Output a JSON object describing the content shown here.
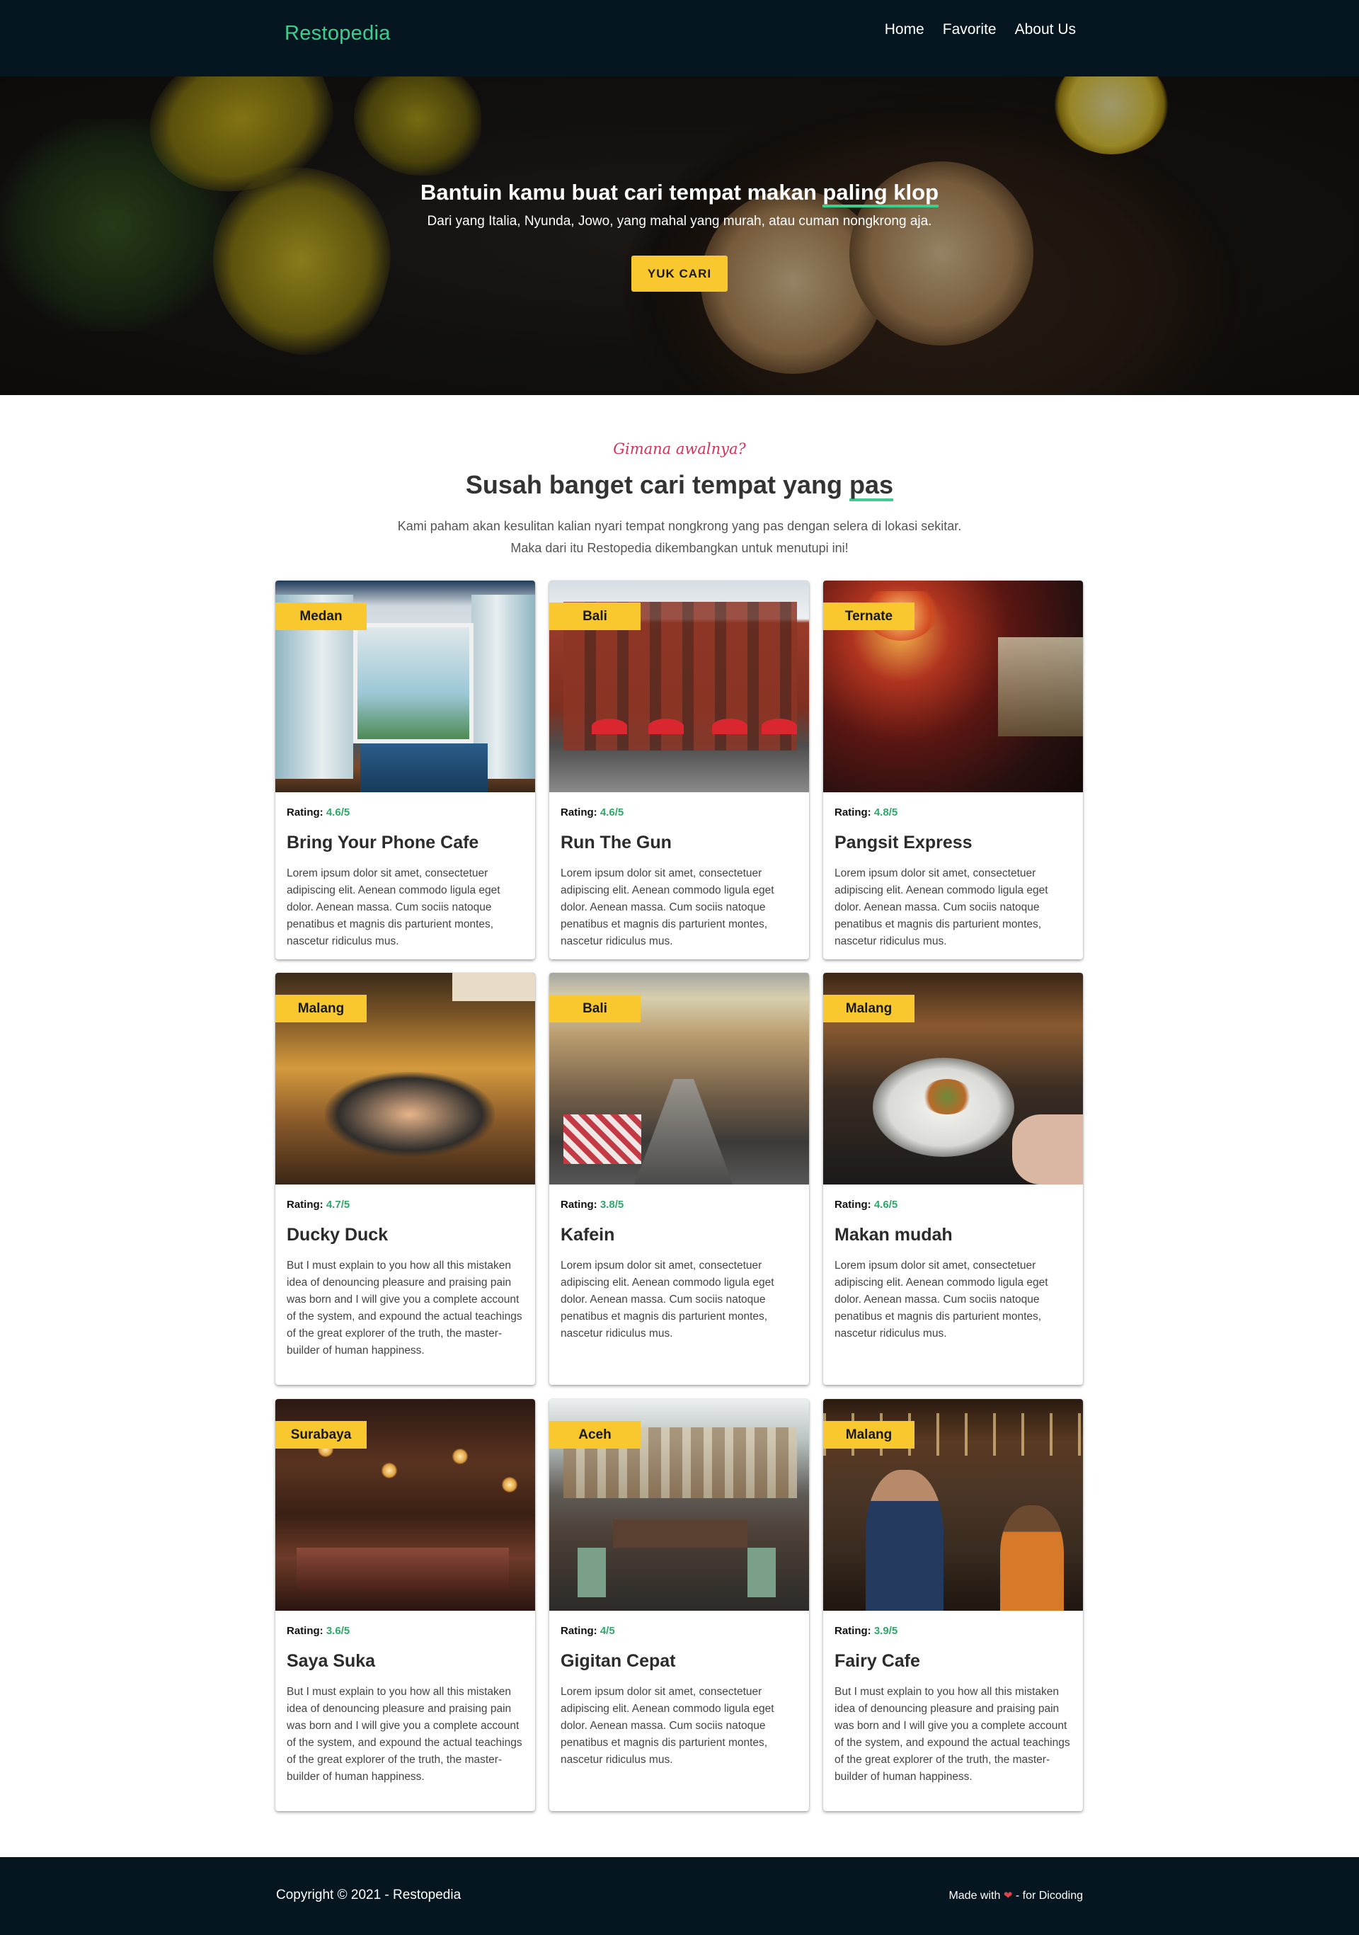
{
  "navbar": {
    "brand": "Restopedia",
    "links": [
      "Home",
      "Favorite",
      "About Us"
    ]
  },
  "hero": {
    "title_prefix": "Bantuin kamu buat cari tempat makan ",
    "title_highlight": "paling klop",
    "subtitle": "Dari yang Italia, Nyunda, Jowo, yang mahal yang murah, atau cuman nongkrong aja.",
    "button_label": "YUK CARI"
  },
  "intro": {
    "kicker": "Gimana awalnya?",
    "title_prefix": "Susah banget cari tempat yang ",
    "title_highlight": "pas",
    "desc_line1": "Kami paham akan kesulitan kalian nyari tempat nongkrong yang pas dengan selera di lokasi sekitar.",
    "desc_line2": "Maka dari itu Restopedia dikembangkan untuk menutupi ini!"
  },
  "rating_label": "Rating:",
  "restaurants": [
    {
      "city": "Medan",
      "rating": "4.6/5",
      "name": "Bring Your Phone Cafe",
      "desc": "Lorem ipsum dolor sit amet, consectetuer adipiscing elit. Aenean commodo ligula eget dolor. Aenean massa. Cum sociis natoque penatibus et magnis dis parturient montes, nascetur ridiculus mus."
    },
    {
      "city": "Bali",
      "rating": "4.6/5",
      "name": "Run The Gun",
      "desc": "Lorem ipsum dolor sit amet, consectetuer adipiscing elit. Aenean commodo ligula eget dolor. Aenean massa. Cum sociis natoque penatibus et magnis dis parturient montes, nascetur ridiculus mus."
    },
    {
      "city": "Ternate",
      "rating": "4.8/5",
      "name": "Pangsit Express",
      "desc": "Lorem ipsum dolor sit amet, consectetuer adipiscing elit. Aenean commodo ligula eget dolor. Aenean massa. Cum sociis natoque penatibus et magnis dis parturient montes, nascetur ridiculus mus."
    },
    {
      "city": "Malang",
      "rating": "4.7/5",
      "name": "Ducky Duck",
      "desc": "But I must explain to you how all this mistaken idea of denouncing pleasure and praising pain was born and I will give you a complete account of the system, and expound the actual teachings of the great explorer of the truth, the master-builder of human happiness."
    },
    {
      "city": "Bali",
      "rating": "3.8/5",
      "name": "Kafein",
      "desc": "Lorem ipsum dolor sit amet, consectetuer adipiscing elit. Aenean commodo ligula eget dolor. Aenean massa. Cum sociis natoque penatibus et magnis dis parturient montes, nascetur ridiculus mus."
    },
    {
      "city": "Malang",
      "rating": "4.6/5",
      "name": "Makan mudah",
      "desc": "Lorem ipsum dolor sit amet, consectetuer adipiscing elit. Aenean commodo ligula eget dolor. Aenean massa. Cum sociis natoque penatibus et magnis dis parturient montes, nascetur ridiculus mus."
    },
    {
      "city": "Surabaya",
      "rating": "3.6/5",
      "name": "Saya Suka",
      "desc": "But I must explain to you how all this mistaken idea of denouncing pleasure and praising pain was born and I will give you a complete account of the system, and expound the actual teachings of the great explorer of the truth, the master-builder of human happiness."
    },
    {
      "city": "Aceh",
      "rating": "4/5",
      "name": "Gigitan Cepat",
      "desc": "Lorem ipsum dolor sit amet, consectetuer adipiscing elit. Aenean commodo ligula eget dolor. Aenean massa. Cum sociis natoque penatibus et magnis dis parturient montes, nascetur ridiculus mus."
    },
    {
      "city": "Malang",
      "rating": "3.9/5",
      "name": "Fairy Cafe",
      "desc": "But I must explain to you how all this mistaken idea of denouncing pleasure and praising pain was born and I will give you a complete account of the system, and expound the actual teachings of the great explorer of the truth, the master-builder of human happiness."
    }
  ],
  "footer": {
    "copyright": "Copyright © 2021 - Restopedia",
    "made_prefix": "Made with",
    "heart_icon": "heart-icon",
    "made_suffix": "- for Dicoding"
  },
  "colors": {
    "navbar_bg": "#061621",
    "brand": "#3bcf8e",
    "accent_yellow": "#f9c72e",
    "rating_green": "#2ea86a",
    "kicker_pink": "#d1345b",
    "underline_green": "#3bcf8e"
  }
}
